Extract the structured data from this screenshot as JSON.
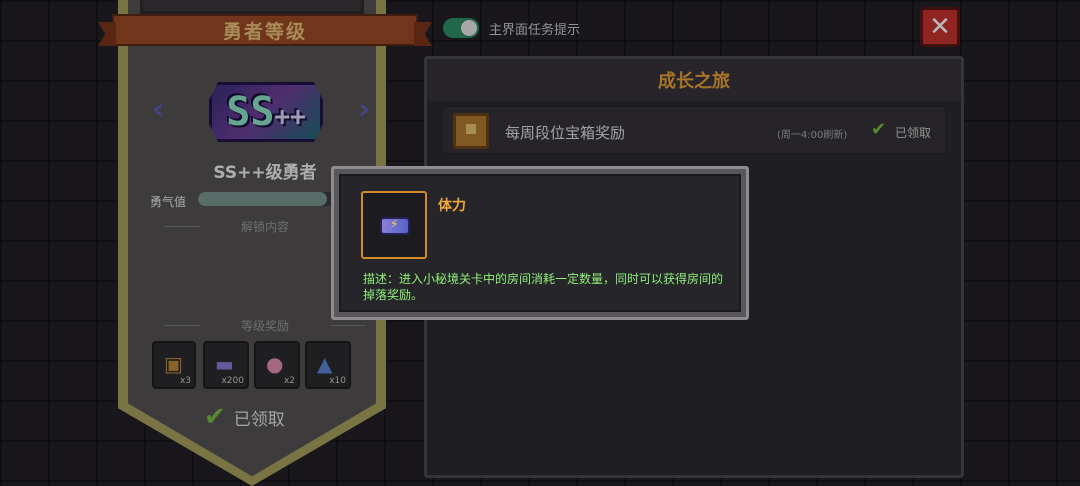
{
  "left_panel": {
    "title": "勇者等级",
    "rank_badge": "SS",
    "rank_badge_plus": "++",
    "rank_name": "SS++级勇者",
    "courage_label": "勇气值",
    "courage_progress": 0.92,
    "unlock_label": "解锁内容",
    "rewards_label": "等级奖励",
    "rewards": [
      {
        "icon": "chest-icon",
        "qty": "x3"
      },
      {
        "icon": "battery-icon",
        "qty": "x200"
      },
      {
        "icon": "paw-icon",
        "qty": "x2"
      },
      {
        "icon": "crystal-icon",
        "qty": "x10"
      }
    ],
    "claimed_label": "已领取",
    "prev_arrow": "‹",
    "next_arrow": "›"
  },
  "top_bar": {
    "toggle_label": "主界面任务提示",
    "toggle_on": true,
    "close_symbol": "✕"
  },
  "journey_panel": {
    "title": "成长之旅",
    "rows": [
      {
        "title": "每周段位宝箱奖励",
        "refresh": "(周一4:00刷新)",
        "status": "已领取"
      }
    ]
  },
  "tooltip": {
    "item_name": "体力",
    "description": "描述：进入小秘境关卡中的房间消耗一定数量，同时可以获得房间的掉落奖励。"
  },
  "colors": {
    "accent_orange": "#f2a93b",
    "desc_green": "#8ff07a",
    "check_green": "#77c043",
    "close_red": "#c8322f"
  }
}
